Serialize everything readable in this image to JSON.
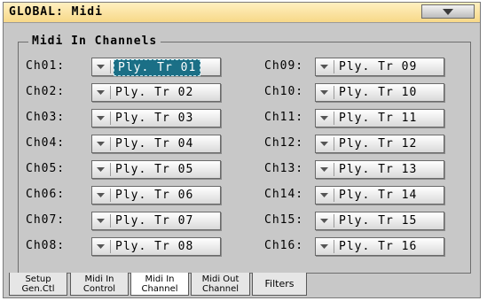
{
  "title": "GLOBAL: Midi",
  "group_label": "Midi In Channels",
  "channels_left": [
    {
      "label": "Ch01:",
      "value": "Ply. Tr 01",
      "selected": true
    },
    {
      "label": "Ch02:",
      "value": "Ply. Tr 02"
    },
    {
      "label": "Ch03:",
      "value": "Ply. Tr 03"
    },
    {
      "label": "Ch04:",
      "value": "Ply. Tr 04"
    },
    {
      "label": "Ch05:",
      "value": "Ply. Tr 05"
    },
    {
      "label": "Ch06:",
      "value": "Ply. Tr 06"
    },
    {
      "label": "Ch07:",
      "value": "Ply. Tr 07"
    },
    {
      "label": "Ch08:",
      "value": "Ply. Tr 08"
    }
  ],
  "channels_right": [
    {
      "label": "Ch09:",
      "value": "Ply. Tr 09"
    },
    {
      "label": "Ch10:",
      "value": "Ply. Tr 10"
    },
    {
      "label": "Ch11:",
      "value": "Ply. Tr 11"
    },
    {
      "label": "Ch12:",
      "value": "Ply. Tr 12"
    },
    {
      "label": "Ch13:",
      "value": "Ply. Tr 13"
    },
    {
      "label": "Ch14:",
      "value": "Ply. Tr 14"
    },
    {
      "label": "Ch15:",
      "value": "Ply. Tr 15"
    },
    {
      "label": "Ch16:",
      "value": "Ply. Tr 16"
    }
  ],
  "tabs": [
    {
      "line1": "Setup",
      "line2": "Gen.Ctl"
    },
    {
      "line1": "Midi In",
      "line2": "Control"
    },
    {
      "line1": "Midi In",
      "line2": "Channel",
      "active": true
    },
    {
      "line1": "Midi Out",
      "line2": "Channel"
    },
    {
      "line1": "Filters",
      "line2": ""
    }
  ],
  "colors": {
    "title_bg": "#f7d888",
    "selected_bg": "#1b6f86",
    "panel_bg": "#c8c8c8"
  },
  "icons": {
    "menu": "triangle-down-icon",
    "combo": "chevron-down-icon"
  }
}
